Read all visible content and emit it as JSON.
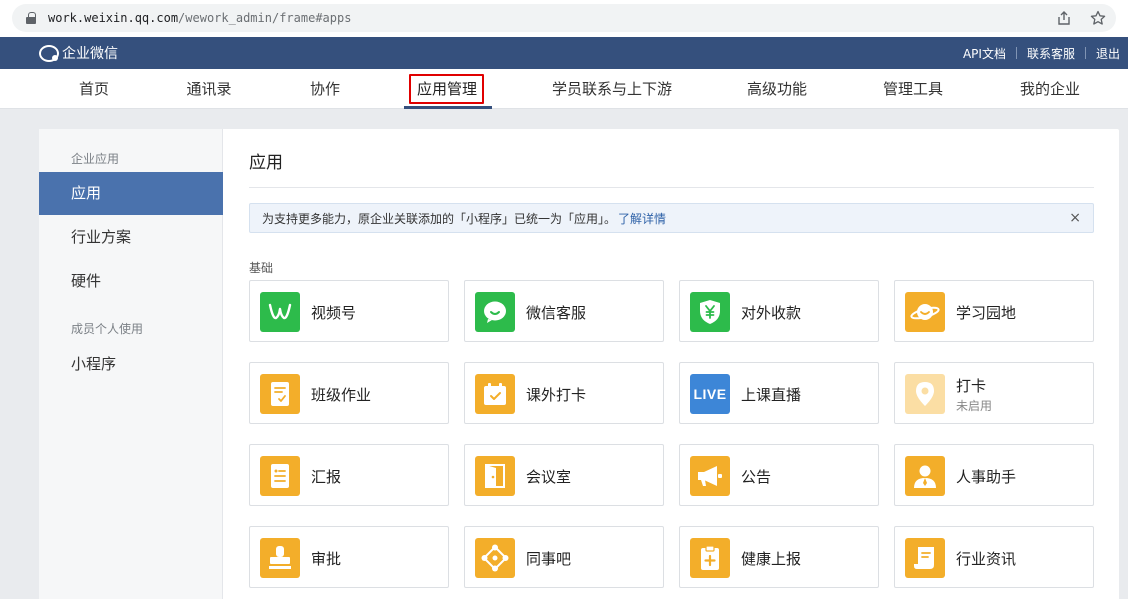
{
  "browser": {
    "url_host": "work.weixin.qq.com",
    "url_path": "/wework_admin/frame#apps"
  },
  "header": {
    "brand": "企业微信",
    "links": [
      "API文档",
      "联系客服",
      "退出"
    ]
  },
  "nav": {
    "items": [
      "首页",
      "通讯录",
      "协作",
      "应用管理",
      "学员联系与上下游",
      "高级功能",
      "管理工具",
      "我的企业"
    ],
    "active": "应用管理"
  },
  "sidebar": {
    "group1": "企业应用",
    "items1": [
      "应用",
      "行业方案",
      "硬件"
    ],
    "group2": "成员个人使用",
    "items2": [
      "小程序"
    ],
    "active": "应用"
  },
  "main": {
    "title": "应用",
    "notice_text": "为支持更多能力，原企业关联添加的「小程序」已统一为「应用」。",
    "notice_link": "了解详情",
    "notice_close": "×",
    "section_label": "基础",
    "apps": [
      {
        "name": "视频号",
        "icon": "channels-icon",
        "color": "#2dbb4b"
      },
      {
        "name": "微信客服",
        "icon": "chat-bubble-icon",
        "color": "#2dbb4b"
      },
      {
        "name": "对外收款",
        "icon": "yuan-shield-icon",
        "color": "#2dbb4b"
      },
      {
        "name": "学习园地",
        "icon": "planet-icon",
        "color": "#f3ae2a"
      },
      {
        "name": "班级作业",
        "icon": "homework-icon",
        "color": "#f3ae2a"
      },
      {
        "name": "课外打卡",
        "icon": "calendar-check-icon",
        "color": "#f3ae2a"
      },
      {
        "name": "上课直播",
        "icon": "live-icon",
        "icon_text": "LIVE",
        "color": "#3d86d7"
      },
      {
        "name": "打卡",
        "status": "未启用",
        "icon": "location-pin-icon",
        "color": "#fbdea4"
      },
      {
        "name": "汇报",
        "icon": "report-icon",
        "color": "#f3ae2a"
      },
      {
        "name": "会议室",
        "icon": "door-icon",
        "color": "#f3ae2a"
      },
      {
        "name": "公告",
        "icon": "megaphone-icon",
        "color": "#f3ae2a"
      },
      {
        "name": "人事助手",
        "icon": "person-icon",
        "color": "#f3ae2a"
      },
      {
        "name": "审批",
        "icon": "stamp-icon",
        "color": "#f3ae2a"
      },
      {
        "name": "同事吧",
        "icon": "network-icon",
        "color": "#f3ae2a"
      },
      {
        "name": "健康上报",
        "icon": "medical-clipboard-icon",
        "color": "#f3ae2a"
      },
      {
        "name": "行业资讯",
        "icon": "scroll-icon",
        "color": "#f3ae2a"
      }
    ]
  }
}
